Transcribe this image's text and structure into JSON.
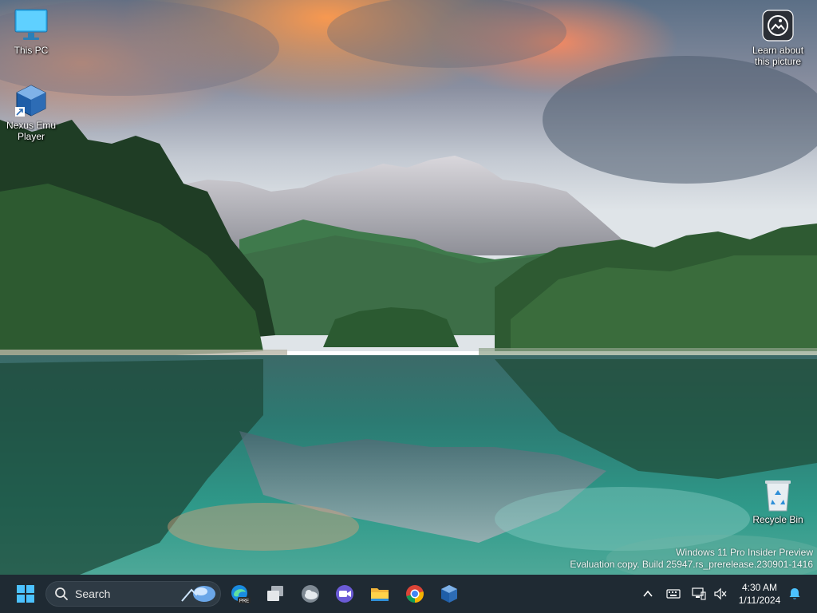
{
  "desktop": {
    "icons": [
      {
        "label": "This PC",
        "icon": "monitor-icon"
      },
      {
        "label": "Nexus Emu Player",
        "icon": "virtualbox-icon"
      },
      {
        "label": "Learn about this picture",
        "icon": "camera-icon"
      },
      {
        "label": "Recycle Bin",
        "icon": "recycle-bin-icon"
      }
    ],
    "watermark": {
      "line1": "Windows 11 Pro Insider Preview",
      "line2": "Evaluation copy. Build 25947.rs_prerelease.230901-1416"
    }
  },
  "taskbar": {
    "search_placeholder": "Search",
    "apps": [
      {
        "name": "Start",
        "icon": "windows-start-icon"
      },
      {
        "name": "Edge Preview",
        "icon": "edge-pre-icon",
        "badge": "PRE"
      },
      {
        "name": "Task View",
        "icon": "task-view-icon"
      },
      {
        "name": "Widgets",
        "icon": "weather-cloud-icon"
      },
      {
        "name": "Teams Meet",
        "icon": "video-call-icon"
      },
      {
        "name": "File Explorer",
        "icon": "folder-icon"
      },
      {
        "name": "Chrome",
        "icon": "chrome-icon"
      },
      {
        "name": "VirtualBox",
        "icon": "virtualbox-icon"
      }
    ],
    "clock": {
      "time": "4:30 AM",
      "date": "1/11/2024"
    }
  },
  "colors": {
    "taskbar_bg": "#1f2a33",
    "accent": "#0078d4"
  }
}
